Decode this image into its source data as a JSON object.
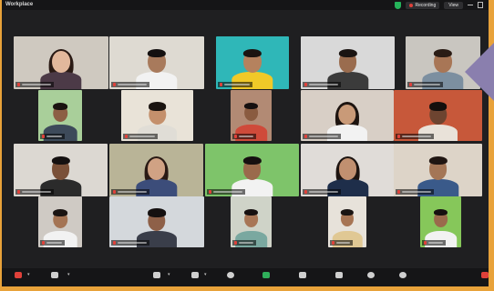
{
  "app": {
    "title": "Workplace"
  },
  "title_bar": {
    "recording_label": "Recording",
    "view_label": "View"
  },
  "colors": {
    "frame": "#e8a23a",
    "window_bg": "#1f1f21",
    "arrow": "#8a7fae",
    "recording": "#e0413a",
    "security": "#25b35a",
    "share": "#2fae5a"
  },
  "participants": [
    {
      "bg": "#cfc9c0",
      "skin": "#e2b89c",
      "hair": "#2a1a14",
      "shirt": "#4c3a47",
      "long_hair": true
    },
    {
      "bg": "#dedad2",
      "skin": "#a87a5c",
      "hair": "#141010",
      "shirt": "#f2f2f2"
    },
    {
      "bg": "#2fb7b8",
      "skin": "#b5825e",
      "hair": "#1b1410",
      "shirt": "#f0c928"
    },
    {
      "bg": "#d9d9d9",
      "skin": "#9a6c4e",
      "hair": "#1a1412",
      "shirt": "#3b3b3b"
    },
    {
      "bg": "#c9c6c0",
      "skin": "#a87656",
      "hair": "#2a1c15",
      "shirt": "#7c8fa0"
    },
    {
      "bg": "#a9cf9a",
      "skin": "#8c5e44",
      "hair": "#1a1310",
      "shirt": "#3d4a5a"
    },
    {
      "bg": "#e9e3d8",
      "skin": "#c4906c",
      "hair": "#1a1410",
      "shirt": "#e0ddd6"
    },
    {
      "bg": "#b28a74",
      "skin": "#8a5b40",
      "hair": "#161010",
      "shirt": "#cf4a3a"
    },
    {
      "bg": "#d8cfc6",
      "skin": "#c99a78",
      "hair": "#1d1410",
      "shirt": "#f2f2f2",
      "long_hair": true
    },
    {
      "bg": "#c7583a",
      "skin": "#6d4430",
      "hair": "#140f0d",
      "shirt": "#e9e2d9"
    },
    {
      "bg": "#dcd8d2",
      "skin": "#7a5038",
      "hair": "#141010",
      "shirt": "#2b2b2b"
    },
    {
      "bg": "#b9b497",
      "skin": "#d0a284",
      "hair": "#2a1a14",
      "shirt": "#3c4d7a",
      "long_hair": true
    },
    {
      "bg": "#7ec46a",
      "skin": "#9a6a4c",
      "hair": "#161010",
      "shirt": "#f2f2f2"
    },
    {
      "bg": "#e0dcd8",
      "skin": "#c19070",
      "hair": "#1d1410",
      "shirt": "#1e2e4a",
      "long_hair": true
    },
    {
      "bg": "#ddd4c8",
      "skin": "#a47656",
      "hair": "#201612",
      "shirt": "#3a5a8a"
    },
    {
      "bg": "#cfcac4",
      "skin": "#a47454",
      "hair": "#1a1412",
      "shirt": "#f2f2f2"
    },
    {
      "bg": "#d4d8dc",
      "skin": "#8e6048",
      "hair": "#141010",
      "shirt": "#3a3e4a"
    },
    {
      "bg": "#cfd3c8",
      "skin": "#a87656",
      "hair": "#161010",
      "shirt": "#7aa8a0"
    },
    {
      "bg": "#e7e2da",
      "skin": "#a77554",
      "hair": "#1a1412",
      "shirt": "#e0c894"
    },
    {
      "bg": "#86c75a",
      "skin": "#9a6a4c",
      "hair": "#161010",
      "shirt": "#f2f2f2"
    }
  ],
  "toolbar": [
    {
      "icon": "mic-muted-icon",
      "color": "#e0413a"
    },
    {
      "icon": "video-icon",
      "color": "#cfcfcf"
    },
    {
      "icon": "participants-icon",
      "color": "#cfcfcf"
    },
    {
      "icon": "chat-icon",
      "color": "#cfcfcf"
    },
    {
      "icon": "reactions-icon",
      "color": "#cfcfcf"
    },
    {
      "icon": "share-screen-icon",
      "color": "#2fae5a"
    },
    {
      "icon": "apps-icon",
      "color": "#cfcfcf"
    },
    {
      "icon": "whiteboard-icon",
      "color": "#cfcfcf"
    },
    {
      "icon": "record-icon",
      "color": "#cfcfcf"
    },
    {
      "icon": "more-icon",
      "color": "#cfcfcf"
    },
    {
      "icon": "leave-icon",
      "color": "#e0413a"
    }
  ]
}
